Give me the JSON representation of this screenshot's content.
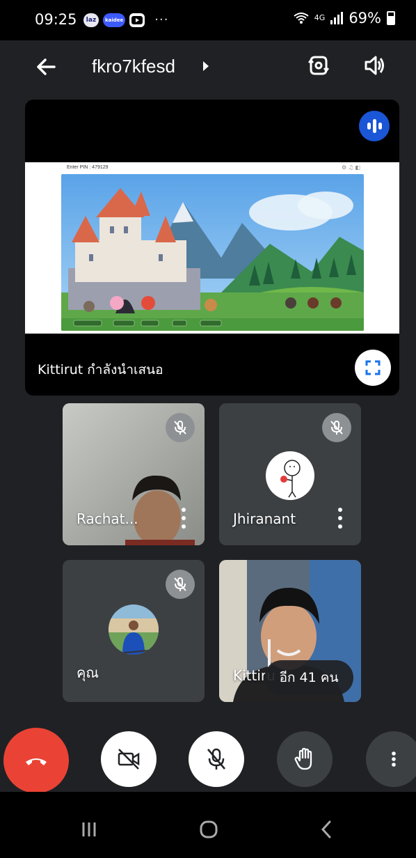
{
  "status_bar": {
    "time": "09:25",
    "apps": [
      "laz",
      "kaidee",
      "youtube"
    ],
    "app_labels": {
      "laz": "laz",
      "kaidee": "kaidee"
    },
    "overflow": "···",
    "network": "4G",
    "battery": "69%",
    "icons": [
      "wifi-icon",
      "signal-icon",
      "battery-icon"
    ]
  },
  "top_bar": {
    "meeting_code": "fkro7kfesd",
    "icons": [
      "back-arrow-icon",
      "chevron-right-icon",
      "switch-camera-icon",
      "speaker-icon"
    ]
  },
  "presentation": {
    "pin_text": "Enter PIN : 479129",
    "presenter_label": "Kittirut กำลังนำเสนอ",
    "icons": [
      "audio-level-icon",
      "fullscreen-icon"
    ]
  },
  "participants": [
    {
      "name": "Rachat...",
      "muted": true
    },
    {
      "name": "Jhiranant",
      "muted": true
    },
    {
      "name": "คุณ",
      "muted": true
    },
    {
      "name": "Kittiru",
      "muted": false
    }
  ],
  "others_pill": "อีก 41 คน",
  "controls": [
    "end-call",
    "camera-off",
    "mic-off",
    "raise-hand",
    "more-options"
  ],
  "colors": {
    "end_call": "#ea4335",
    "audio_badge": "#1a56d6",
    "tile_bg": "#3c4043",
    "background": "#202124"
  }
}
